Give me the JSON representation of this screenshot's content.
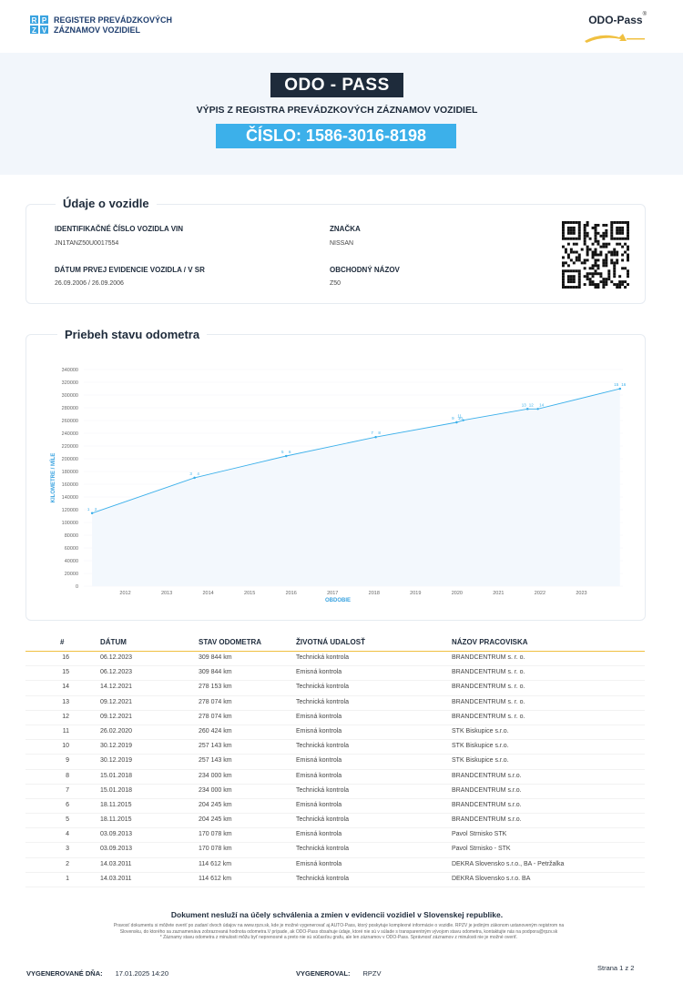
{
  "header": {
    "rpzv_letters": [
      "R",
      "P",
      "Z",
      "V"
    ],
    "rpzv_title_line1": "REGISTER PREVÁDZKOVÝCH",
    "rpzv_title_line2": "ZÁZNAMOV VOZIDIEL",
    "odo_logo": "ODO-Pass",
    "odo_logo_reg": "®",
    "colors": {
      "accent": "#3cb0ea",
      "dark": "#1e2b3b",
      "gold": "#f0c040"
    }
  },
  "hero": {
    "badge": "ODO - PASS",
    "subtitle": "VÝPIS Z REGISTRA PREVÁDZKOVÝCH ZÁZNAMOV VOZIDIEL",
    "number": "ČÍSLO: 1586-3016-8198"
  },
  "vehicle": {
    "title": "Údaje o vozidle",
    "vin_label": "IDENTIFIKAČNÉ ČÍSLO VOZIDLA VIN",
    "vin_value": "JN1TANZ50U0017554",
    "brand_label": "ZNAČKA",
    "brand_value": "NISSAN",
    "first_reg_label": "DÁTUM PRVEJ EVIDENCIE VOZIDLA / V SR",
    "first_reg_value": "26.09.2006 / 26.09.2006",
    "trade_name_label": "OBCHODNÝ NÁZOV",
    "trade_name_value": "Z50"
  },
  "chart_title": "Priebeh stavu odometra",
  "chart_data": {
    "type": "line",
    "xlabel": "OBDOBIE",
    "ylabel": "KILOMETRE / MÍLE",
    "ylim": [
      0,
      340000
    ],
    "y_ticks": [
      "0",
      "20000",
      "40000",
      "60000",
      "80000",
      "100000",
      "120000",
      "140000",
      "160000",
      "180000",
      "200000",
      "220000",
      "240000",
      "260000",
      "280000",
      "300000",
      "320000",
      "340000"
    ],
    "x_range": [
      2011.0,
      2024.0
    ],
    "x_ticks": [
      "2012",
      "2013",
      "2014",
      "2015",
      "2016",
      "2017",
      "2018",
      "2019",
      "2020",
      "2021",
      "2022",
      "2023"
    ],
    "points": [
      {
        "x": 2011.2,
        "y": 114612,
        "label": "1"
      },
      {
        "x": 2011.2,
        "y": 114612,
        "label": "2"
      },
      {
        "x": 2013.67,
        "y": 170078,
        "label": "3"
      },
      {
        "x": 2013.67,
        "y": 170078,
        "label": "4"
      },
      {
        "x": 2015.88,
        "y": 204245,
        "label": "5"
      },
      {
        "x": 2015.88,
        "y": 204245,
        "label": "6"
      },
      {
        "x": 2018.04,
        "y": 234000,
        "label": "7"
      },
      {
        "x": 2018.04,
        "y": 234000,
        "label": "8"
      },
      {
        "x": 2019.99,
        "y": 257143,
        "label": "9"
      },
      {
        "x": 2019.99,
        "y": 257143,
        "label": "10"
      },
      {
        "x": 2020.15,
        "y": 260424,
        "label": "11"
      },
      {
        "x": 2021.7,
        "y": 278074,
        "label": "12"
      },
      {
        "x": 2021.7,
        "y": 278074,
        "label": "13"
      },
      {
        "x": 2021.95,
        "y": 278153,
        "label": "14"
      },
      {
        "x": 2023.93,
        "y": 309844,
        "label": "15"
      },
      {
        "x": 2023.93,
        "y": 309844,
        "label": "16"
      }
    ],
    "line_color": "#3cb0ea"
  },
  "table": {
    "headers": [
      "#",
      "DÁTUM",
      "STAV ODOMETRA",
      "ŽIVOTNÁ UDALOSŤ",
      "NÁZOV PRACOVISKA"
    ],
    "rows": [
      [
        "16",
        "06.12.2023",
        "309 844 km",
        "Technická kontrola",
        "BRANDCENTRUM s. r. o."
      ],
      [
        "15",
        "06.12.2023",
        "309 844 km",
        "Emisná kontrola",
        "BRANDCENTRUM s. r. o."
      ],
      [
        "14",
        "14.12.2021",
        "278 153 km",
        "Technická kontrola",
        "BRANDCENTRUM s. r. o."
      ],
      [
        "13",
        "09.12.2021",
        "278 074 km",
        "Technická kontrola",
        "BRANDCENTRUM s. r. o."
      ],
      [
        "12",
        "09.12.2021",
        "278 074 km",
        "Emisná kontrola",
        "BRANDCENTRUM s. r. o."
      ],
      [
        "11",
        "26.02.2020",
        "260 424 km",
        "Emisná kontrola",
        "STK Biskupice s.r.o."
      ],
      [
        "10",
        "30.12.2019",
        "257 143 km",
        "Technická kontrola",
        "STK Biskupice s.r.o."
      ],
      [
        "9",
        "30.12.2019",
        "257 143 km",
        "Emisná kontrola",
        "STK Biskupice s.r.o."
      ],
      [
        "8",
        "15.01.2018",
        "234 000 km",
        "Emisná kontrola",
        "BRANDCENTRUM s.r.o."
      ],
      [
        "7",
        "15.01.2018",
        "234 000 km",
        "Technická kontrola",
        "BRANDCENTRUM s.r.o."
      ],
      [
        "6",
        "18.11.2015",
        "204 245 km",
        "Emisná kontrola",
        "BRANDCENTRUM s.r.o."
      ],
      [
        "5",
        "18.11.2015",
        "204 245 km",
        "Technická kontrola",
        "BRANDCENTRUM s.r.o."
      ],
      [
        "4",
        "03.09.2013",
        "170 078 km",
        "Emisná kontrola",
        "Pavol Strnisko STK"
      ],
      [
        "3",
        "03.09.2013",
        "170 078 km",
        "Technická kontrola",
        "Pavol Strnisko - STK"
      ],
      [
        "2",
        "14.03.2011",
        "114 612 km",
        "Emisná kontrola",
        "DEKRA Slovensko s.r.o., BA - Petržalka"
      ],
      [
        "1",
        "14.03.2011",
        "114 612 km",
        "Technická kontrola",
        "DEKRA Slovensko s.r.o. BA"
      ]
    ]
  },
  "footer": {
    "disclaimer_bold": "Dokument nesluží na účely schválenia a zmien v evidencii vozidiel v Slovenskej republike.",
    "disclaimer_line1": "Pravosť dokumentu si môžete overiť po zadaní dvoch údajov na www.rpzv.sk, kde je možné vygenerovať aj AUTO-Pass, ktorý poskytuje komplexné informácie o vozidle. RPZV je jediným zákonom ustanoveným registrom na",
    "disclaimer_line2": "Slovensku, do ktorého sa zaznamenáva zobrazovaná hodnota odometra.V prípade, ak ODO-Pass obsahuje údaje, ktoré nie sú v súlade s transparentným vývojom stavu odometra, kontaktujte nás na podpora@rpzv.sk",
    "disclaimer_line3": "* Záznamy stavu odometra z minulosti môžu byť neprenosné a preto nie sú súčasťou grafu, ale len záznamov v ODO-Pass. Správnosť záznamov z minulosti nie je možné overiť.",
    "generated_label": "VYGENEROVANÉ DŇA:",
    "generated_value": "17.01.2025  14:20",
    "generated_by_label": "VYGENEROVAL:",
    "generated_by_value": "RPZV",
    "page": "Strana 1 z 2"
  }
}
